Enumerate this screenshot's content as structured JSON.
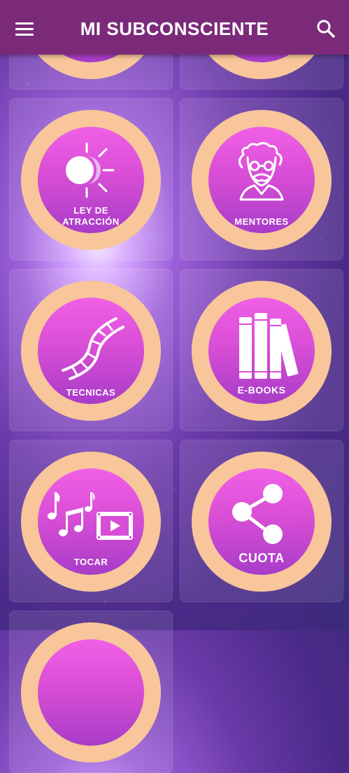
{
  "header": {
    "title": "MI SUBCONSCIENTE",
    "menu_icon": "hamburger-menu-icon",
    "search_icon": "search-icon",
    "background": "#7b2a7a"
  },
  "tiles": [
    {
      "label_line1": "LEY DE",
      "label_line2": "ATRACCIÓN",
      "icon": "sun-moon-icon"
    },
    {
      "label": "MENTORES",
      "icon": "elderly-man-icon"
    },
    {
      "label": "TECNICAS",
      "icon": "dna-icon"
    },
    {
      "label": "E-BOOKS",
      "icon": "books-icon"
    },
    {
      "label": "TOCAR",
      "icon": "music-video-icon"
    },
    {
      "label": "CUOTA",
      "icon": "share-icon"
    }
  ],
  "colors": {
    "ring": "#f8c69a",
    "circle": "#e056dc",
    "accent": "#7b2a7a"
  }
}
